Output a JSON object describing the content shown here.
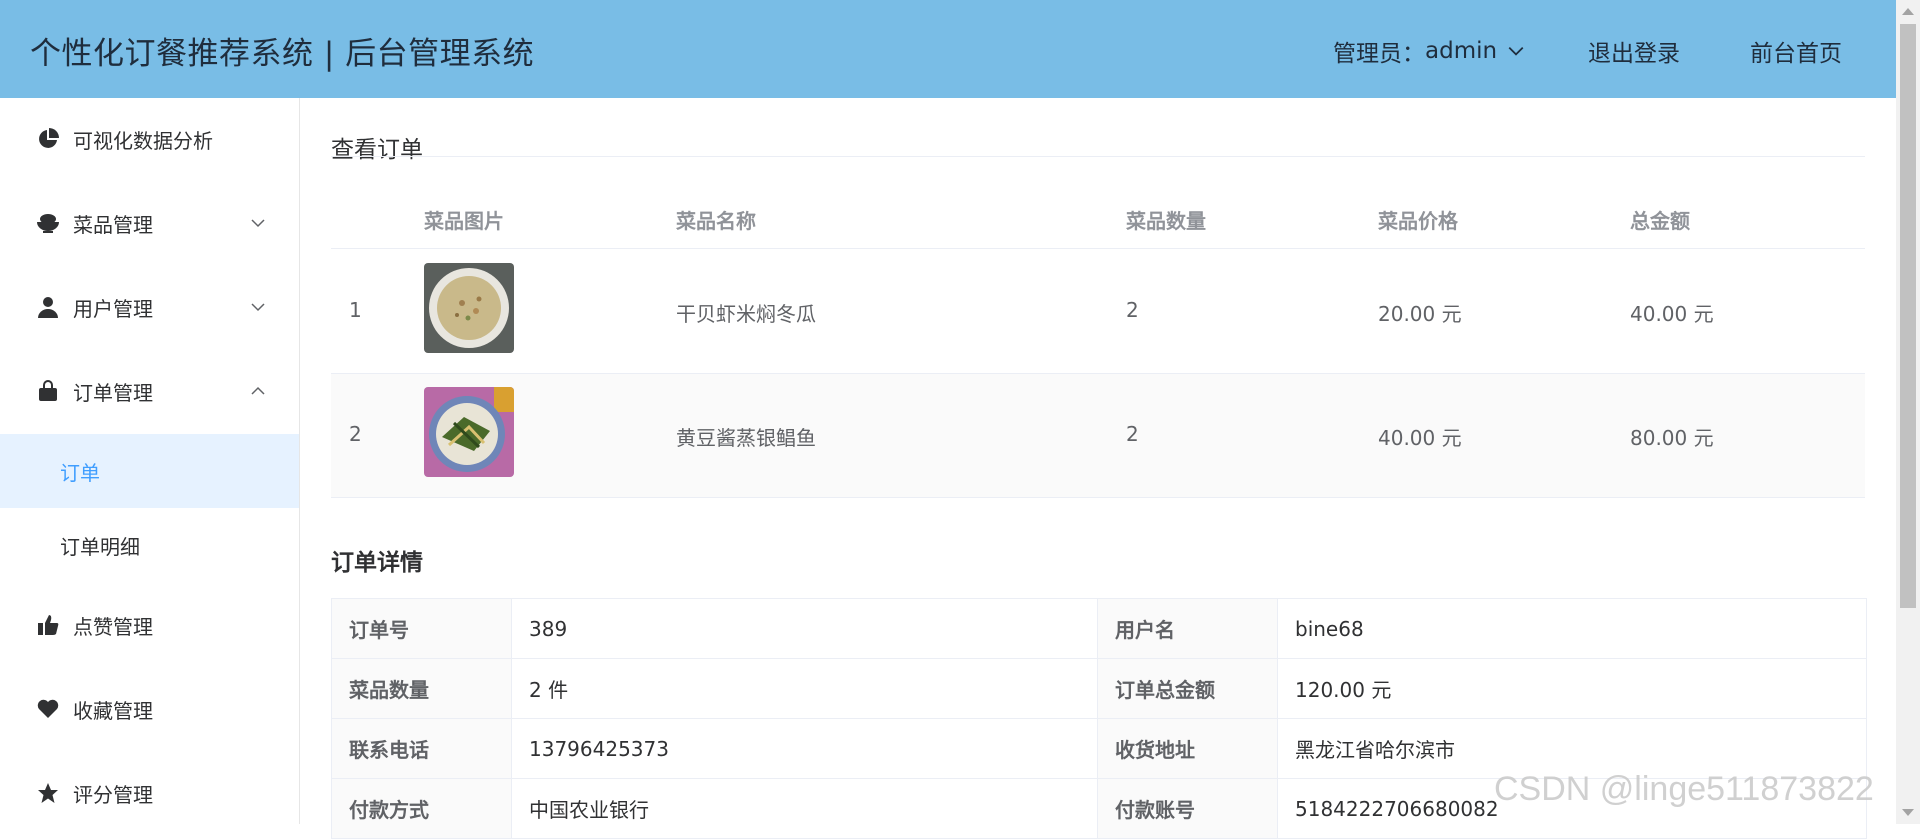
{
  "header": {
    "title": "个性化订餐推荐系统 | 后台管理系统",
    "admin_label": "管理员：",
    "admin_user": "admin",
    "logout": "退出登录",
    "front_home": "前台首页",
    "background_color": "#79bde6"
  },
  "sidebar": {
    "items": [
      {
        "label": "可视化数据分析",
        "icon": "pie-chart-icon"
      },
      {
        "label": "菜品管理",
        "icon": "rice-bowl-icon",
        "expanded": false
      },
      {
        "label": "用户管理",
        "icon": "user-icon",
        "expanded": false
      },
      {
        "label": "订单管理",
        "icon": "shopping-bag-icon",
        "expanded": true
      },
      {
        "label": "点赞管理",
        "icon": "thumbs-up-icon"
      },
      {
        "label": "收藏管理",
        "icon": "heart-icon"
      },
      {
        "label": "评分管理",
        "icon": "star-icon"
      }
    ],
    "sub_items": [
      {
        "label": "订单",
        "active": true
      },
      {
        "label": "订单明细",
        "active": false
      }
    ],
    "active_color": "#409eff"
  },
  "main": {
    "page_title": "查看订单",
    "table": {
      "headers": [
        "菜品图片",
        "菜品名称",
        "菜品数量",
        "菜品价格",
        "总金额"
      ],
      "rows": [
        {
          "index": "1",
          "name": "干贝虾米焖冬瓜",
          "qty": "2",
          "price": "20.00 元",
          "total": "40.00 元"
        },
        {
          "index": "2",
          "name": "黄豆酱蒸银鲳鱼",
          "qty": "2",
          "price": "40.00 元",
          "total": "80.00 元"
        }
      ]
    },
    "detail_title": "订单详情",
    "details": [
      {
        "l1": "订单号",
        "v1": "389",
        "l2": "用户名",
        "v2": "bine68"
      },
      {
        "l1": "菜品数量",
        "v1": "2 件",
        "l2": "订单总金额",
        "v2": "120.00 元"
      },
      {
        "l1": "联系电话",
        "v1": "13796425373",
        "l2": "收货地址",
        "v2": "黑龙江省哈尔滨市"
      },
      {
        "l1": "付款方式",
        "v1": "中国农业银行",
        "l2": "付款账号",
        "v2": "5184222706680082"
      }
    ]
  },
  "watermark": "CSDN @linge511873822"
}
